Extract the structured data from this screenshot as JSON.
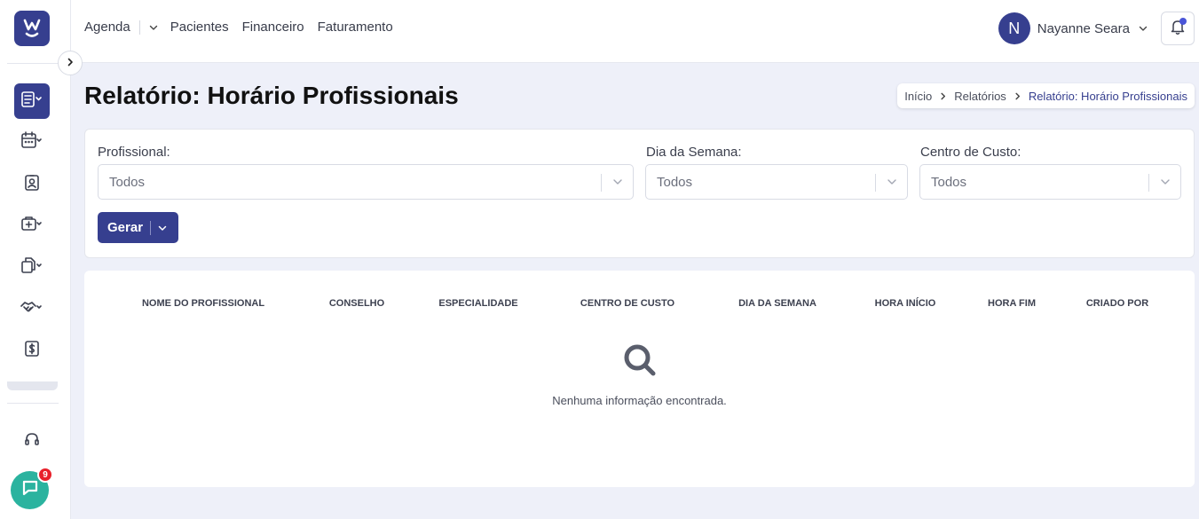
{
  "sidebar": {
    "logo_icon": "brand-logo-icon",
    "items": [
      {
        "icon": "report-icon",
        "active": true
      },
      {
        "icon": "calendar-icon",
        "active": false
      },
      {
        "icon": "patient-badge-icon",
        "active": false
      },
      {
        "icon": "medical-case-icon",
        "active": false
      },
      {
        "icon": "documents-icon",
        "active": false
      },
      {
        "icon": "handshake-icon",
        "active": false
      },
      {
        "icon": "dollar-icon",
        "active": false
      }
    ],
    "support_icon": "headset-icon",
    "chat_badge": "9"
  },
  "topbar": {
    "nav": [
      {
        "label": "Agenda"
      },
      {
        "label": "Pacientes"
      },
      {
        "label": "Financeiro"
      },
      {
        "label": "Faturamento"
      }
    ],
    "user": {
      "initial": "N",
      "name": "Nayanne Seara"
    }
  },
  "page": {
    "title": "Relatório: Horário Profissionais",
    "breadcrumb": [
      "Início",
      "Relatórios",
      "Relatório: Horário Profissionais"
    ]
  },
  "filters": {
    "profissional": {
      "label": "Profissional:",
      "value": "Todos"
    },
    "dia_semana": {
      "label": "Dia da Semana:",
      "value": "Todos"
    },
    "centro_custo": {
      "label": "Centro de Custo:",
      "value": "Todos"
    },
    "generate_label": "Gerar"
  },
  "table": {
    "columns": [
      "NOME DO PROFISSIONAL",
      "CONSELHO",
      "ESPECIALIDADE",
      "CENTRO DE CUSTO",
      "DIA DA SEMANA",
      "HORA INÍCIO",
      "HORA FIM",
      "CRIADO POR"
    ],
    "rows": [],
    "empty_message": "Nenhuma informação encontrada."
  },
  "colors": {
    "primary": "#363f8f",
    "chat": "#2bb39f",
    "badge": "#e8202a",
    "background": "#eef0f9"
  }
}
